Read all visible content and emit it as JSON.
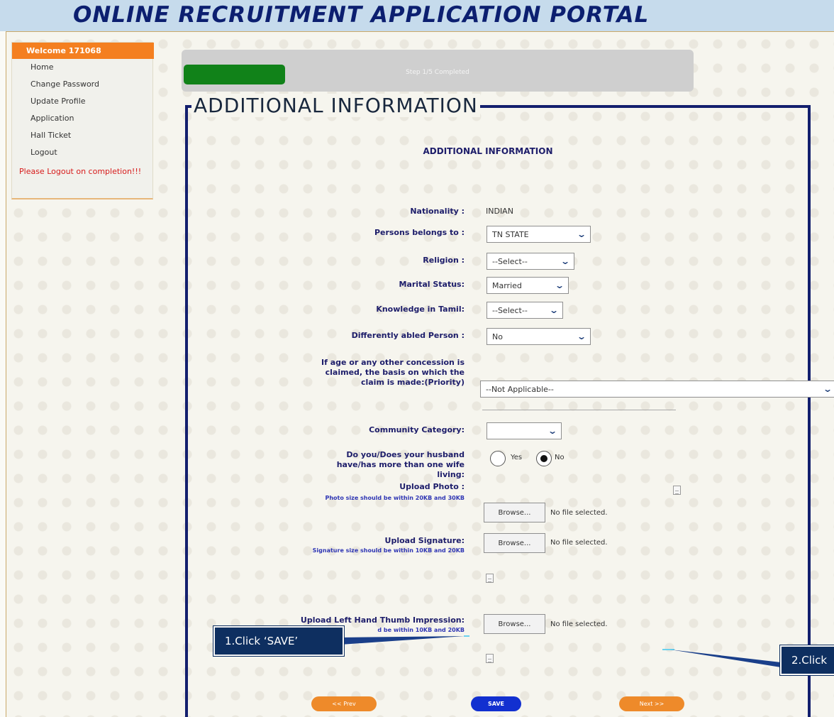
{
  "header": {
    "title": "ONLINE RECRUITMENT APPLICATION PORTAL"
  },
  "sidebar": {
    "welcome": "Welcome 171068",
    "items": [
      "Home",
      "Change Password",
      "Update Profile",
      "Application",
      "Hall Ticket",
      "Logout"
    ],
    "note": "Please Logout on completion!!!"
  },
  "progress": {
    "text": "Step 1/5 Completed",
    "fraction": 0.2
  },
  "section": {
    "legend": "ADDITIONAL INFORMATION",
    "heading": "ADDITIONAL INFORMATION"
  },
  "form": {
    "nationality": {
      "label": "Nationality :",
      "value": "INDIAN"
    },
    "persons_belong": {
      "label": "Persons belongs to :",
      "value": "TN STATE"
    },
    "religion": {
      "label": "Religion :",
      "value": "--Select--"
    },
    "marital_status": {
      "label": "Marital Status:",
      "value": "Married"
    },
    "knowledge_tamil": {
      "label": "Knowledge in Tamil:",
      "value": "--Select--"
    },
    "differently_abled": {
      "label": "Differently abled Person :",
      "value": "No"
    },
    "concession": {
      "label": "If age or any other concession is claimed, the basis on which the claim is made:(Priority)",
      "value": "--Not Applicable--"
    },
    "community": {
      "label": "Community Category:",
      "value": ""
    },
    "wife_living": {
      "label": "Do you/Does your husband have/has more than one wife living:",
      "yes_label": "Yes",
      "no_label": "No",
      "selected": "No"
    },
    "upload_photo": {
      "label": "Upload Photo :",
      "hint": "Photo size should be within 20KB and 30KB",
      "button": "Browse...",
      "status": "No file selected."
    },
    "upload_signature": {
      "label": "Upload Signature:",
      "hint": "Signature size should be within 10KB and 20KB",
      "button": "Browse...",
      "status": "No file selected."
    },
    "upload_thumb": {
      "label": "Upload Left Hand Thumb Impression:",
      "hint": "d be within 10KB and 20KB",
      "button": "Browse...",
      "status": "No file selected."
    }
  },
  "callouts": {
    "save": "1.Click ‘SAVE’",
    "next": "2.Click"
  },
  "buttons": {
    "prev": "<< Prev",
    "save": "SAVE",
    "next": "Next >>"
  },
  "colors": {
    "header_bg": "#c6dbec",
    "title": "#0c1f70",
    "accent_orange": "#f47f20",
    "progress_green": "#118219",
    "fieldset_border": "#131f6e",
    "save_blue": "#1230d0",
    "callout_bg": "#0e2f60"
  },
  "icons": [
    "file-icon",
    "chevron-down-icon",
    "radio-icon"
  ]
}
